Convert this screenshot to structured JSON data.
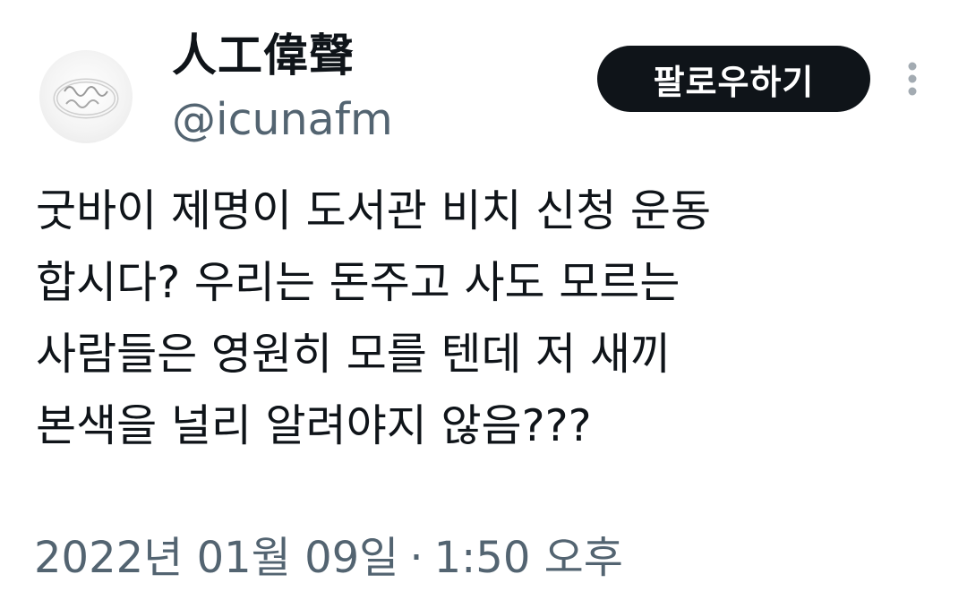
{
  "user": {
    "display_name": "人工偉聲",
    "handle": "@icunafm",
    "avatar_icon": "ring-photo-avatar"
  },
  "actions": {
    "follow_label": "팔로우하기",
    "more_icon": "more-vertical-icon"
  },
  "tweet": {
    "lines": [
      "굿바이 제명이 도서관 비치 신청 운동",
      "합시다? 우리는 돈주고 사도 모르는",
      "사람들은 영원히 모를 텐데 저 새끼",
      "본색을 널리 알려야지 않음???"
    ]
  },
  "meta": {
    "date": "2022년 01월 09일",
    "separator": "·",
    "time": "1:50 오후"
  },
  "colors": {
    "text": "#0f1419",
    "secondary": "#536471",
    "button_bg": "#0f1419",
    "button_text": "#ffffff"
  }
}
